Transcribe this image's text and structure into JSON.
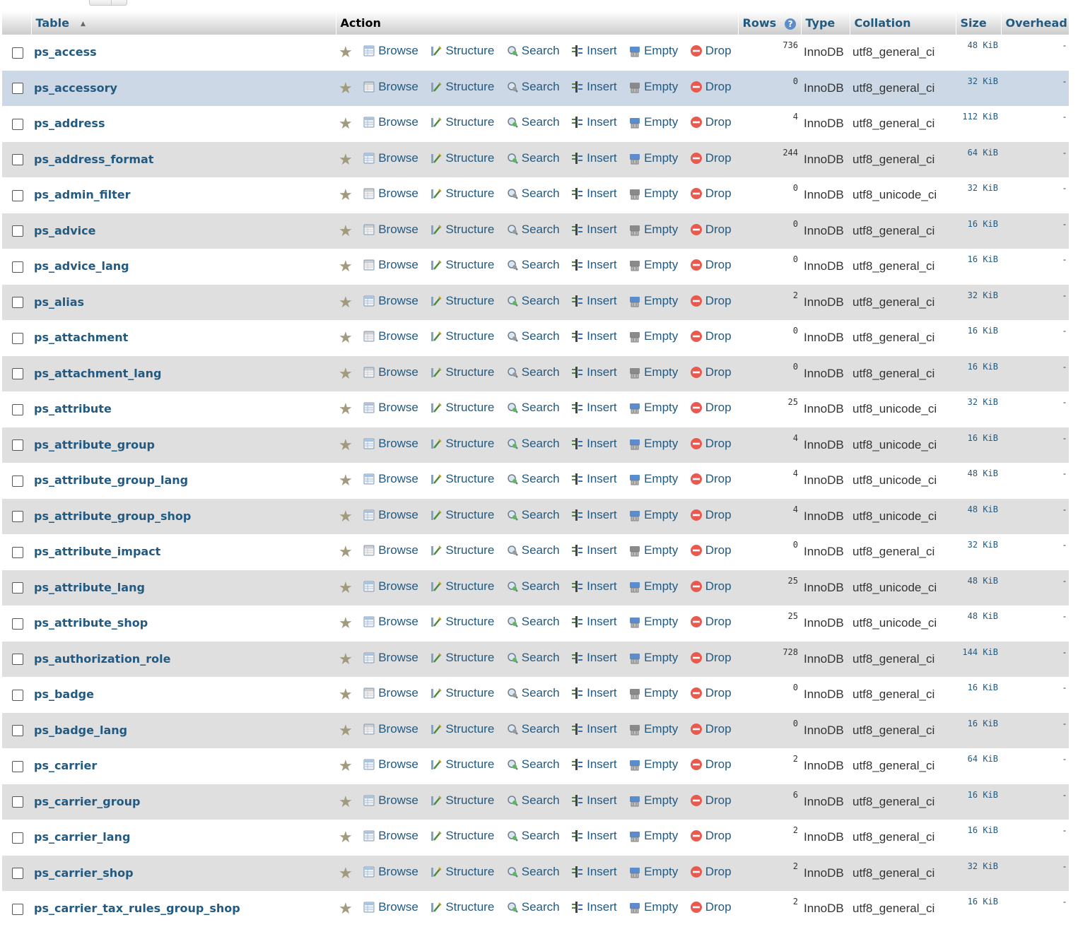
{
  "header": {
    "table": "Table",
    "action": "Action",
    "rows": "Rows",
    "type": "Type",
    "collation": "Collation",
    "size": "Size",
    "overhead": "Overhead"
  },
  "actions": {
    "browse": "Browse",
    "structure": "Structure",
    "search": "Search",
    "insert": "Insert",
    "empty": "Empty",
    "drop": "Drop"
  },
  "colors": {
    "link": "#235a81",
    "drop": "#e85a4f",
    "star": "#a29a7d"
  },
  "tables": [
    {
      "name": "ps_access",
      "rows": "736",
      "type": "InnoDB",
      "collation": "utf8_general_ci",
      "size": "48 KiB",
      "overhead": "-",
      "empty": false
    },
    {
      "name": "ps_accessory",
      "rows": "0",
      "type": "InnoDB",
      "collation": "utf8_general_ci",
      "size": "32 KiB",
      "overhead": "-",
      "empty": true
    },
    {
      "name": "ps_address",
      "rows": "4",
      "type": "InnoDB",
      "collation": "utf8_general_ci",
      "size": "112 KiB",
      "overhead": "-",
      "empty": false
    },
    {
      "name": "ps_address_format",
      "rows": "244",
      "type": "InnoDB",
      "collation": "utf8_general_ci",
      "size": "64 KiB",
      "overhead": "-",
      "empty": false
    },
    {
      "name": "ps_admin_filter",
      "rows": "0",
      "type": "InnoDB",
      "collation": "utf8_unicode_ci",
      "size": "32 KiB",
      "overhead": "-",
      "empty": true
    },
    {
      "name": "ps_advice",
      "rows": "0",
      "type": "InnoDB",
      "collation": "utf8_general_ci",
      "size": "16 KiB",
      "overhead": "-",
      "empty": true
    },
    {
      "name": "ps_advice_lang",
      "rows": "0",
      "type": "InnoDB",
      "collation": "utf8_general_ci",
      "size": "16 KiB",
      "overhead": "-",
      "empty": true
    },
    {
      "name": "ps_alias",
      "rows": "2",
      "type": "InnoDB",
      "collation": "utf8_general_ci",
      "size": "32 KiB",
      "overhead": "-",
      "empty": false
    },
    {
      "name": "ps_attachment",
      "rows": "0",
      "type": "InnoDB",
      "collation": "utf8_general_ci",
      "size": "16 KiB",
      "overhead": "-",
      "empty": true
    },
    {
      "name": "ps_attachment_lang",
      "rows": "0",
      "type": "InnoDB",
      "collation": "utf8_general_ci",
      "size": "16 KiB",
      "overhead": "-",
      "empty": true
    },
    {
      "name": "ps_attribute",
      "rows": "25",
      "type": "InnoDB",
      "collation": "utf8_unicode_ci",
      "size": "32 KiB",
      "overhead": "-",
      "empty": false
    },
    {
      "name": "ps_attribute_group",
      "rows": "4",
      "type": "InnoDB",
      "collation": "utf8_unicode_ci",
      "size": "16 KiB",
      "overhead": "-",
      "empty": false
    },
    {
      "name": "ps_attribute_group_lang",
      "rows": "4",
      "type": "InnoDB",
      "collation": "utf8_unicode_ci",
      "size": "48 KiB",
      "overhead": "-",
      "empty": false
    },
    {
      "name": "ps_attribute_group_shop",
      "rows": "4",
      "type": "InnoDB",
      "collation": "utf8_unicode_ci",
      "size": "48 KiB",
      "overhead": "-",
      "empty": false
    },
    {
      "name": "ps_attribute_impact",
      "rows": "0",
      "type": "InnoDB",
      "collation": "utf8_general_ci",
      "size": "32 KiB",
      "overhead": "-",
      "empty": true
    },
    {
      "name": "ps_attribute_lang",
      "rows": "25",
      "type": "InnoDB",
      "collation": "utf8_unicode_ci",
      "size": "48 KiB",
      "overhead": "-",
      "empty": false
    },
    {
      "name": "ps_attribute_shop",
      "rows": "25",
      "type": "InnoDB",
      "collation": "utf8_unicode_ci",
      "size": "48 KiB",
      "overhead": "-",
      "empty": false
    },
    {
      "name": "ps_authorization_role",
      "rows": "728",
      "type": "InnoDB",
      "collation": "utf8_general_ci",
      "size": "144 KiB",
      "overhead": "-",
      "empty": false
    },
    {
      "name": "ps_badge",
      "rows": "0",
      "type": "InnoDB",
      "collation": "utf8_general_ci",
      "size": "16 KiB",
      "overhead": "-",
      "empty": true
    },
    {
      "name": "ps_badge_lang",
      "rows": "0",
      "type": "InnoDB",
      "collation": "utf8_general_ci",
      "size": "16 KiB",
      "overhead": "-",
      "empty": true
    },
    {
      "name": "ps_carrier",
      "rows": "2",
      "type": "InnoDB",
      "collation": "utf8_general_ci",
      "size": "64 KiB",
      "overhead": "-",
      "empty": false
    },
    {
      "name": "ps_carrier_group",
      "rows": "6",
      "type": "InnoDB",
      "collation": "utf8_general_ci",
      "size": "16 KiB",
      "overhead": "-",
      "empty": false
    },
    {
      "name": "ps_carrier_lang",
      "rows": "2",
      "type": "InnoDB",
      "collation": "utf8_general_ci",
      "size": "16 KiB",
      "overhead": "-",
      "empty": false
    },
    {
      "name": "ps_carrier_shop",
      "rows": "2",
      "type": "InnoDB",
      "collation": "utf8_general_ci",
      "size": "32 KiB",
      "overhead": "-",
      "empty": false
    },
    {
      "name": "ps_carrier_tax_rules_group_shop",
      "rows": "2",
      "type": "InnoDB",
      "collation": "utf8_general_ci",
      "size": "16 KiB",
      "overhead": "-",
      "empty": false
    }
  ]
}
